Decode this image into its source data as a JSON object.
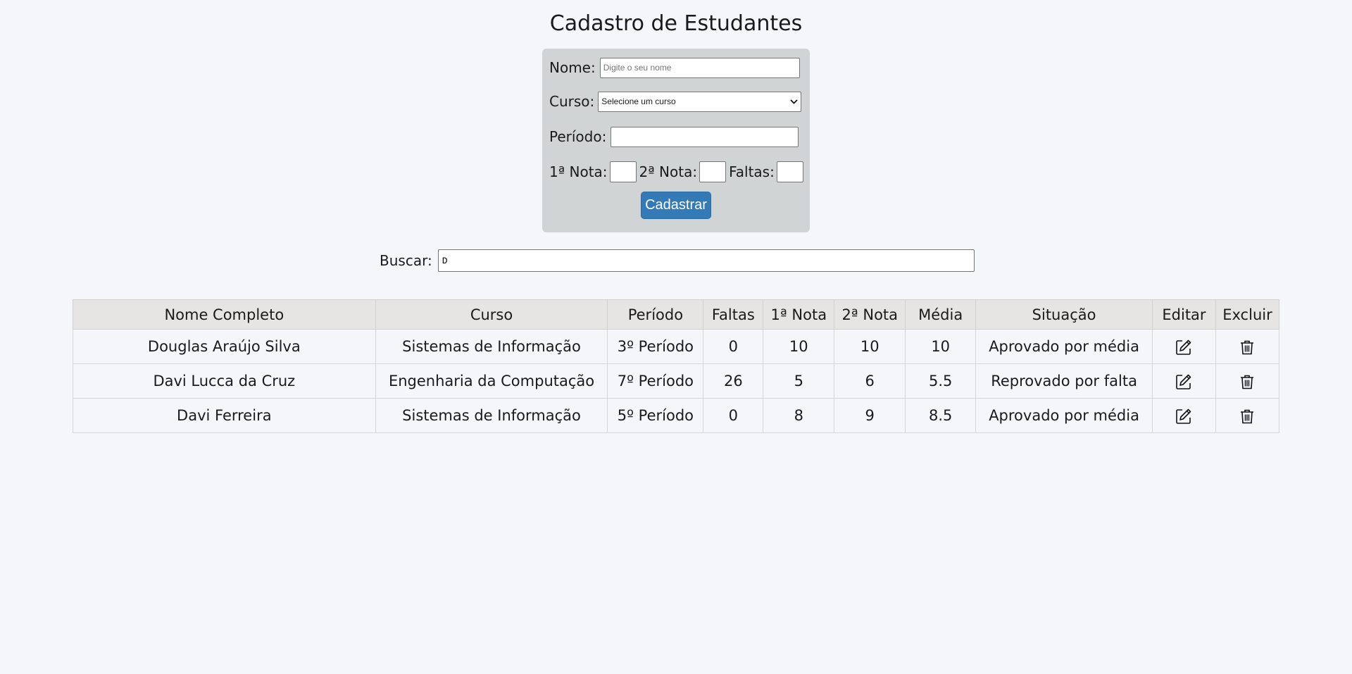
{
  "page": {
    "title": "Cadastro de Estudantes"
  },
  "form": {
    "nome_label": "Nome:",
    "nome_placeholder": "Digite o seu nome",
    "nome_value": "",
    "curso_label": "Curso:",
    "curso_selected": "Selecione um curso",
    "periodo_label": "Período:",
    "periodo_value": "",
    "nota1_label": "1ª Nota:",
    "nota2_label": "2ª Nota:",
    "faltas_label": "Faltas:",
    "submit_label": "Cadastrar"
  },
  "search": {
    "label": "Buscar:",
    "value": "D"
  },
  "table": {
    "headers": {
      "nome": "Nome Completo",
      "curso": "Curso",
      "periodo": "Período",
      "faltas": "Faltas",
      "nota1": "1ª Nota",
      "nota2": "2ª Nota",
      "media": "Média",
      "situacao": "Situação",
      "editar": "Editar",
      "excluir": "Excluir"
    },
    "rows": [
      {
        "nome": "Douglas Araújo Silva",
        "curso": "Sistemas de Informação",
        "periodo": "3º Período",
        "faltas": "0",
        "nota1": "10",
        "nota2": "10",
        "media": "10",
        "situacao": "Aprovado por média"
      },
      {
        "nome": "Davi Lucca da Cruz",
        "curso": "Engenharia da Computação",
        "periodo": "7º Período",
        "faltas": "26",
        "nota1": "5",
        "nota2": "6",
        "media": "5.5",
        "situacao": "Reprovado por falta"
      },
      {
        "nome": "Davi Ferreira",
        "curso": "Sistemas de Informação",
        "periodo": "5º Período",
        "faltas": "0",
        "nota1": "8",
        "nota2": "9",
        "media": "8.5",
        "situacao": "Aprovado por média"
      }
    ]
  },
  "icons": {
    "edit": "edit-icon",
    "delete": "trash-icon"
  },
  "colors": {
    "background": "#f5f6fa",
    "form_card": "#d1d4d5",
    "primary_button": "#337ab7",
    "table_header": "#e6e5e3"
  }
}
